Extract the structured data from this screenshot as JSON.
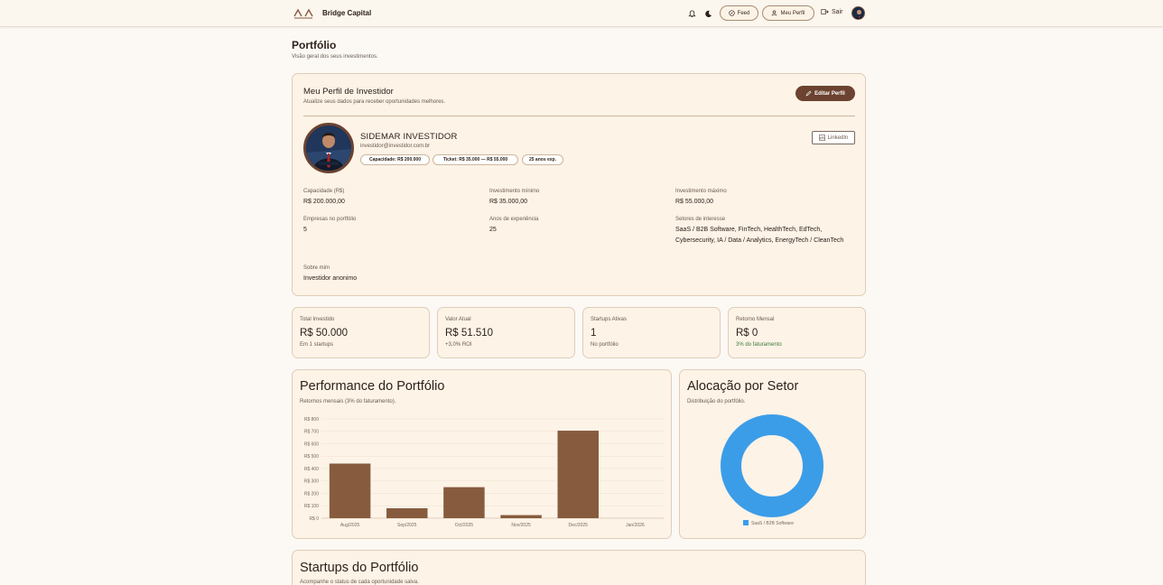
{
  "header": {
    "brand": "Bridge Capital",
    "feed_label": "Feed",
    "profile_label": "Meu Perfil",
    "logout_label": "Sair",
    "icons": [
      "bell-icon",
      "moon-icon",
      "compass-icon",
      "user-icon",
      "logout-icon"
    ]
  },
  "page": {
    "title": "Portfólio",
    "subtitle": "Visão geral dos seus investimentos."
  },
  "profile": {
    "title": "Meu Perfil de Investidor",
    "subtitle": "Atualize seus dados para receber oportunidades melhores.",
    "edit_label": "Editar Perfil",
    "name": "SIDEMAR INVESTIDOR",
    "email": "investidor@investidor.com.br",
    "chips": [
      "Capacidade: R$ 200.000",
      "Ticket: R$ 35.000 — R$ 55.000",
      "25 anos exp."
    ],
    "linkedin_label": "LinkedIn",
    "fields": {
      "capacidade": {
        "label": "Capacidade (R$)",
        "value": "R$ 200.000,00"
      },
      "inv_min": {
        "label": "Investimento mínimo",
        "value": "R$ 35.000,00"
      },
      "inv_max": {
        "label": "Investimento máximo",
        "value": "R$ 55.000,00"
      },
      "empresas": {
        "label": "Empresas no portfólio",
        "value": "5"
      },
      "anos": {
        "label": "Anos de experiência",
        "value": "25"
      },
      "setores": {
        "label": "Setores de interesse",
        "value": "SaaS / B2B Software, FinTech, HealthTech, EdTech, Cybersecurity, IA / Data / Analytics, EnergyTech / CleanTech"
      },
      "sobre": {
        "label": "Sobre mim",
        "value": "Investidor anonimo"
      }
    }
  },
  "stats": [
    {
      "label": "Total Investido",
      "value": "R$ 50.000",
      "sub": "Em 1 startups"
    },
    {
      "label": "Valor Atual",
      "value": "R$ 51.510",
      "sub": "+3,0% ROI"
    },
    {
      "label": "Startups Ativas",
      "value": "1",
      "sub": "No portfólio"
    },
    {
      "label": "Retorno Mensal",
      "value": "R$ 0",
      "sub": "3% do faturamento"
    }
  ],
  "colors": {
    "accent": "#6b4330",
    "bar": "#875b3e",
    "donut": "#3b9de8",
    "positive": "#3b7a3b"
  },
  "chart_data": [
    {
      "type": "bar",
      "title": "Performance do Portfólio",
      "subtitle": "Retornos mensais (3% do faturamento).",
      "categories": [
        "Aug/2025",
        "Sep/2025",
        "Oct/2025",
        "Nov/2025",
        "Dec/2025",
        "Jan/2026"
      ],
      "values": [
        440,
        80,
        250,
        25,
        705,
        0
      ],
      "ylim": [
        0,
        800
      ],
      "yticks": [
        "R$ 0",
        "R$ 100",
        "R$ 200",
        "R$ 300",
        "R$ 400",
        "R$ 500",
        "R$ 600",
        "R$ 700",
        "R$ 800"
      ],
      "grid": true
    },
    {
      "type": "pie",
      "title": "Alocação por Setor",
      "subtitle": "Distribuição do portfólio.",
      "categories": [
        "SaaS / B2B Software"
      ],
      "values": [
        100
      ],
      "legend": "bottom"
    }
  ],
  "startups": {
    "title": "Startups do Portfólio",
    "subtitle": "Acompanhe o status de cada oportunidade salva."
  }
}
